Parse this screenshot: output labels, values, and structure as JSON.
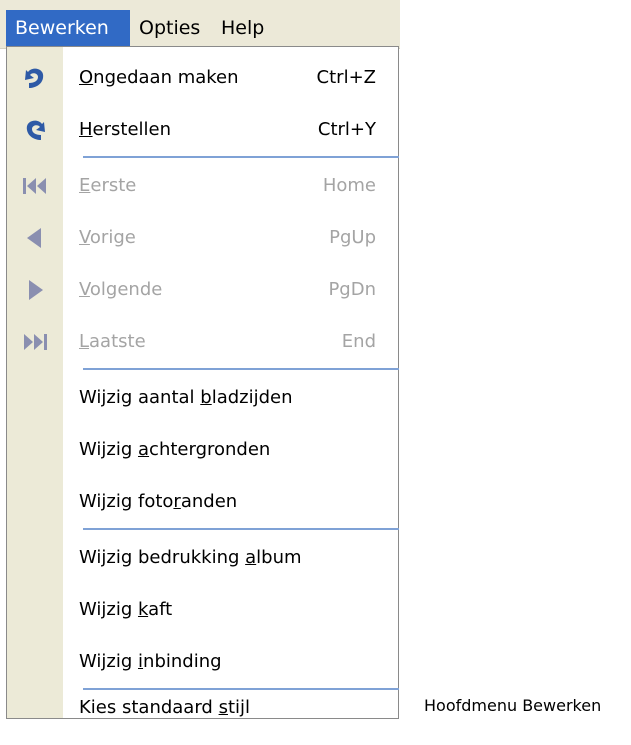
{
  "menubar": {
    "items": [
      {
        "label": "Bewerken",
        "active": true
      },
      {
        "label": "Opties",
        "active": false
      },
      {
        "label": "Help",
        "active": false
      }
    ]
  },
  "dropdown": {
    "items": [
      {
        "pre": "",
        "mn": "O",
        "post": "ngedaan maken",
        "shortcut": "Ctrl+Z",
        "icon": "undo-icon",
        "enabled": true
      },
      {
        "pre": "",
        "mn": "H",
        "post": "erstellen",
        "shortcut": "Ctrl+Y",
        "icon": "redo-icon",
        "enabled": true
      },
      {
        "pre": "",
        "mn": "E",
        "post": "erste",
        "shortcut": "Home",
        "icon": "first-page-icon",
        "enabled": false
      },
      {
        "pre": "",
        "mn": "V",
        "post": "orige",
        "shortcut": "PgUp",
        "icon": "previous-page-icon",
        "enabled": false
      },
      {
        "pre": "",
        "mn": "V",
        "post": "olgende",
        "shortcut": "PgDn",
        "icon": "next-page-icon",
        "enabled": false
      },
      {
        "pre": "",
        "mn": "L",
        "post": "aatste",
        "shortcut": "End",
        "icon": "last-page-icon",
        "enabled": false
      },
      {
        "pre": "Wijzig aantal ",
        "mn": "b",
        "post": "ladzijden",
        "shortcut": "",
        "icon": "",
        "enabled": true
      },
      {
        "pre": "Wijzig ",
        "mn": "a",
        "post": "chtergronden",
        "shortcut": "",
        "icon": "",
        "enabled": true
      },
      {
        "pre": "Wijzig foto",
        "mn": "r",
        "post": "anden",
        "shortcut": "",
        "icon": "",
        "enabled": true
      },
      {
        "pre": "Wijzig bedrukking ",
        "mn": "a",
        "post": "lbum",
        "shortcut": "",
        "icon": "",
        "enabled": true
      },
      {
        "pre": "Wijzig ",
        "mn": "k",
        "post": "aft",
        "shortcut": "",
        "icon": "",
        "enabled": true
      },
      {
        "pre": "Wijzig ",
        "mn": "i",
        "post": "nbinding",
        "shortcut": "",
        "icon": "",
        "enabled": true
      },
      {
        "pre": "Kies standaard ",
        "mn": "s",
        "post": "tijl",
        "shortcut": "",
        "icon": "",
        "enabled": true
      }
    ]
  },
  "caption": "Hoofdmenu Bewerken",
  "colors": {
    "highlight": "#316ac5",
    "icon_blue": "#2e5aa6",
    "icon_disabled": "#8a8fb0",
    "disabled_text": "#a4a4a4",
    "separator": "#7fa2d6"
  }
}
